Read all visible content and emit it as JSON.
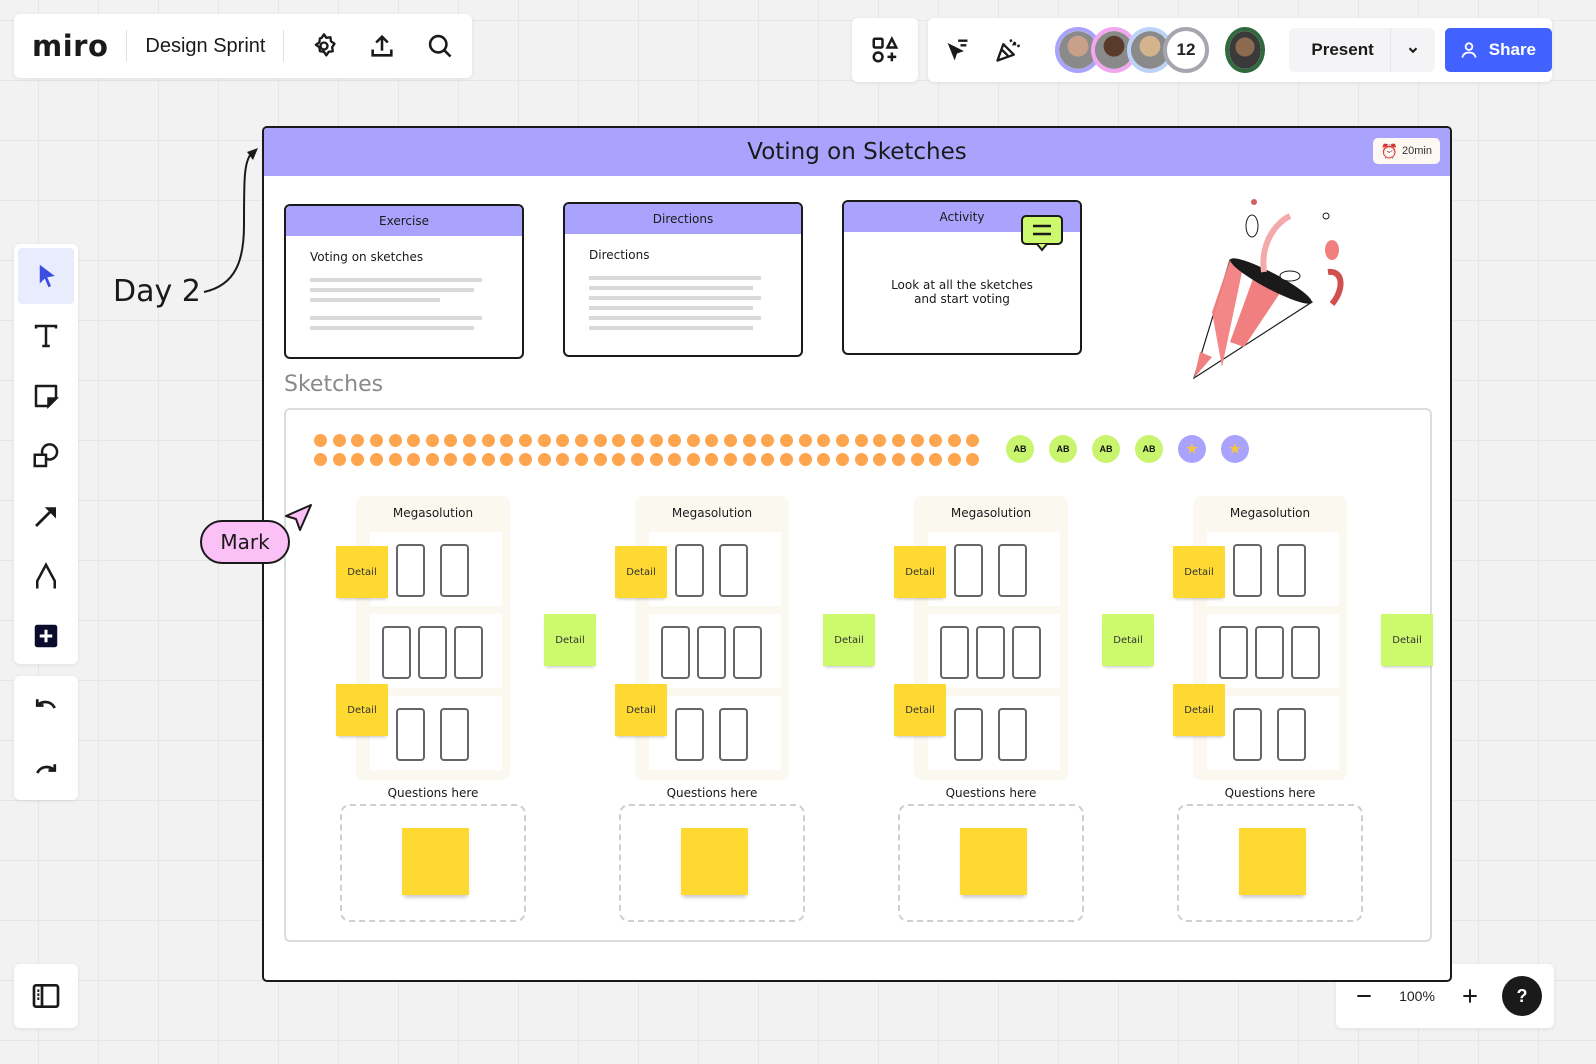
{
  "app": {
    "logo": "miro",
    "board_title": "Design Sprint"
  },
  "top_left_actions": [
    {
      "name": "settings",
      "icon": "gear-icon"
    },
    {
      "name": "export",
      "icon": "upload-icon"
    },
    {
      "name": "search",
      "icon": "search-icon"
    }
  ],
  "top_right": {
    "apps_icon": "shapes-plus-icon",
    "tools": [
      {
        "name": "reactions-cursor",
        "icon": "cursor-filter-icon"
      },
      {
        "name": "celebrate",
        "icon": "party-popper-icon"
      }
    ],
    "collaborators": [
      {
        "ring_color": "#a9a3fd",
        "face_color": "#c9a08a"
      },
      {
        "ring_color": "#f2a6f0",
        "face_color": "#5a3a2a"
      },
      {
        "ring_color": "#bcd3f7",
        "face_color": "#d4b48c"
      }
    ],
    "collaborator_overflow_count": "12",
    "current_user": {
      "ring_color": "#2e6a3e",
      "face_color": "#8c6a50"
    },
    "present_label": "Present",
    "share_label": "Share",
    "share_color": "#4262ff"
  },
  "toolbar": {
    "tools": [
      {
        "name": "select",
        "icon": "cursor-icon",
        "active": true
      },
      {
        "name": "text",
        "icon": "text-icon",
        "active": false
      },
      {
        "name": "sticky-note",
        "icon": "sticky-note-icon",
        "active": false
      },
      {
        "name": "shapes",
        "icon": "shapes-icon",
        "active": false
      },
      {
        "name": "connection-line",
        "icon": "arrow-icon",
        "active": false
      },
      {
        "name": "pen",
        "icon": "pen-icon",
        "active": false
      },
      {
        "name": "more-tools",
        "icon": "plus-icon",
        "active": false
      }
    ],
    "history": [
      {
        "name": "undo",
        "icon": "undo-icon"
      },
      {
        "name": "redo",
        "icon": "redo-icon"
      }
    ]
  },
  "zoom": {
    "level": "100%",
    "help": "?"
  },
  "annotation": {
    "day_label": "Day 2"
  },
  "frame": {
    "title": "Voting on Sketches",
    "timer": "20min",
    "header_color": "#a9a3fd",
    "cards": [
      {
        "header": "Exercise",
        "subtitle": "Voting on sketches"
      },
      {
        "header": "Directions",
        "subtitle": "Directions"
      },
      {
        "header": "Activity",
        "body_line1": "Look at all the sketches",
        "body_line2": "and start voting"
      }
    ],
    "sketches_label": "Sketches",
    "vote_dots_per_row": 36,
    "vote_dot_rows": 2,
    "vote_dot_color": "#fea550",
    "badges": [
      {
        "type": "ab",
        "label": "AB"
      },
      {
        "type": "ab",
        "label": "AB"
      },
      {
        "type": "ab",
        "label": "AB"
      },
      {
        "type": "ab",
        "label": "AB"
      },
      {
        "type": "star",
        "label": "★"
      },
      {
        "type": "star",
        "label": "★"
      }
    ],
    "solutions": [
      {
        "title": "Megasolution",
        "details": [
          "Detail",
          "Detail",
          "Detail"
        ],
        "questions_label": "Questions here"
      },
      {
        "title": "Megasolution",
        "details": [
          "Detail",
          "Detail",
          "Detail"
        ],
        "questions_label": "Questions here"
      },
      {
        "title": "Megasolution",
        "details": [
          "Detail",
          "Detail",
          "Detail"
        ],
        "questions_label": "Questions here"
      },
      {
        "title": "Megasolution",
        "details": [
          "Detail",
          "Detail",
          "Detail"
        ],
        "questions_label": "Questions here"
      }
    ]
  },
  "cursor_label": {
    "name": "Mark",
    "color": "#fbc0f6"
  }
}
